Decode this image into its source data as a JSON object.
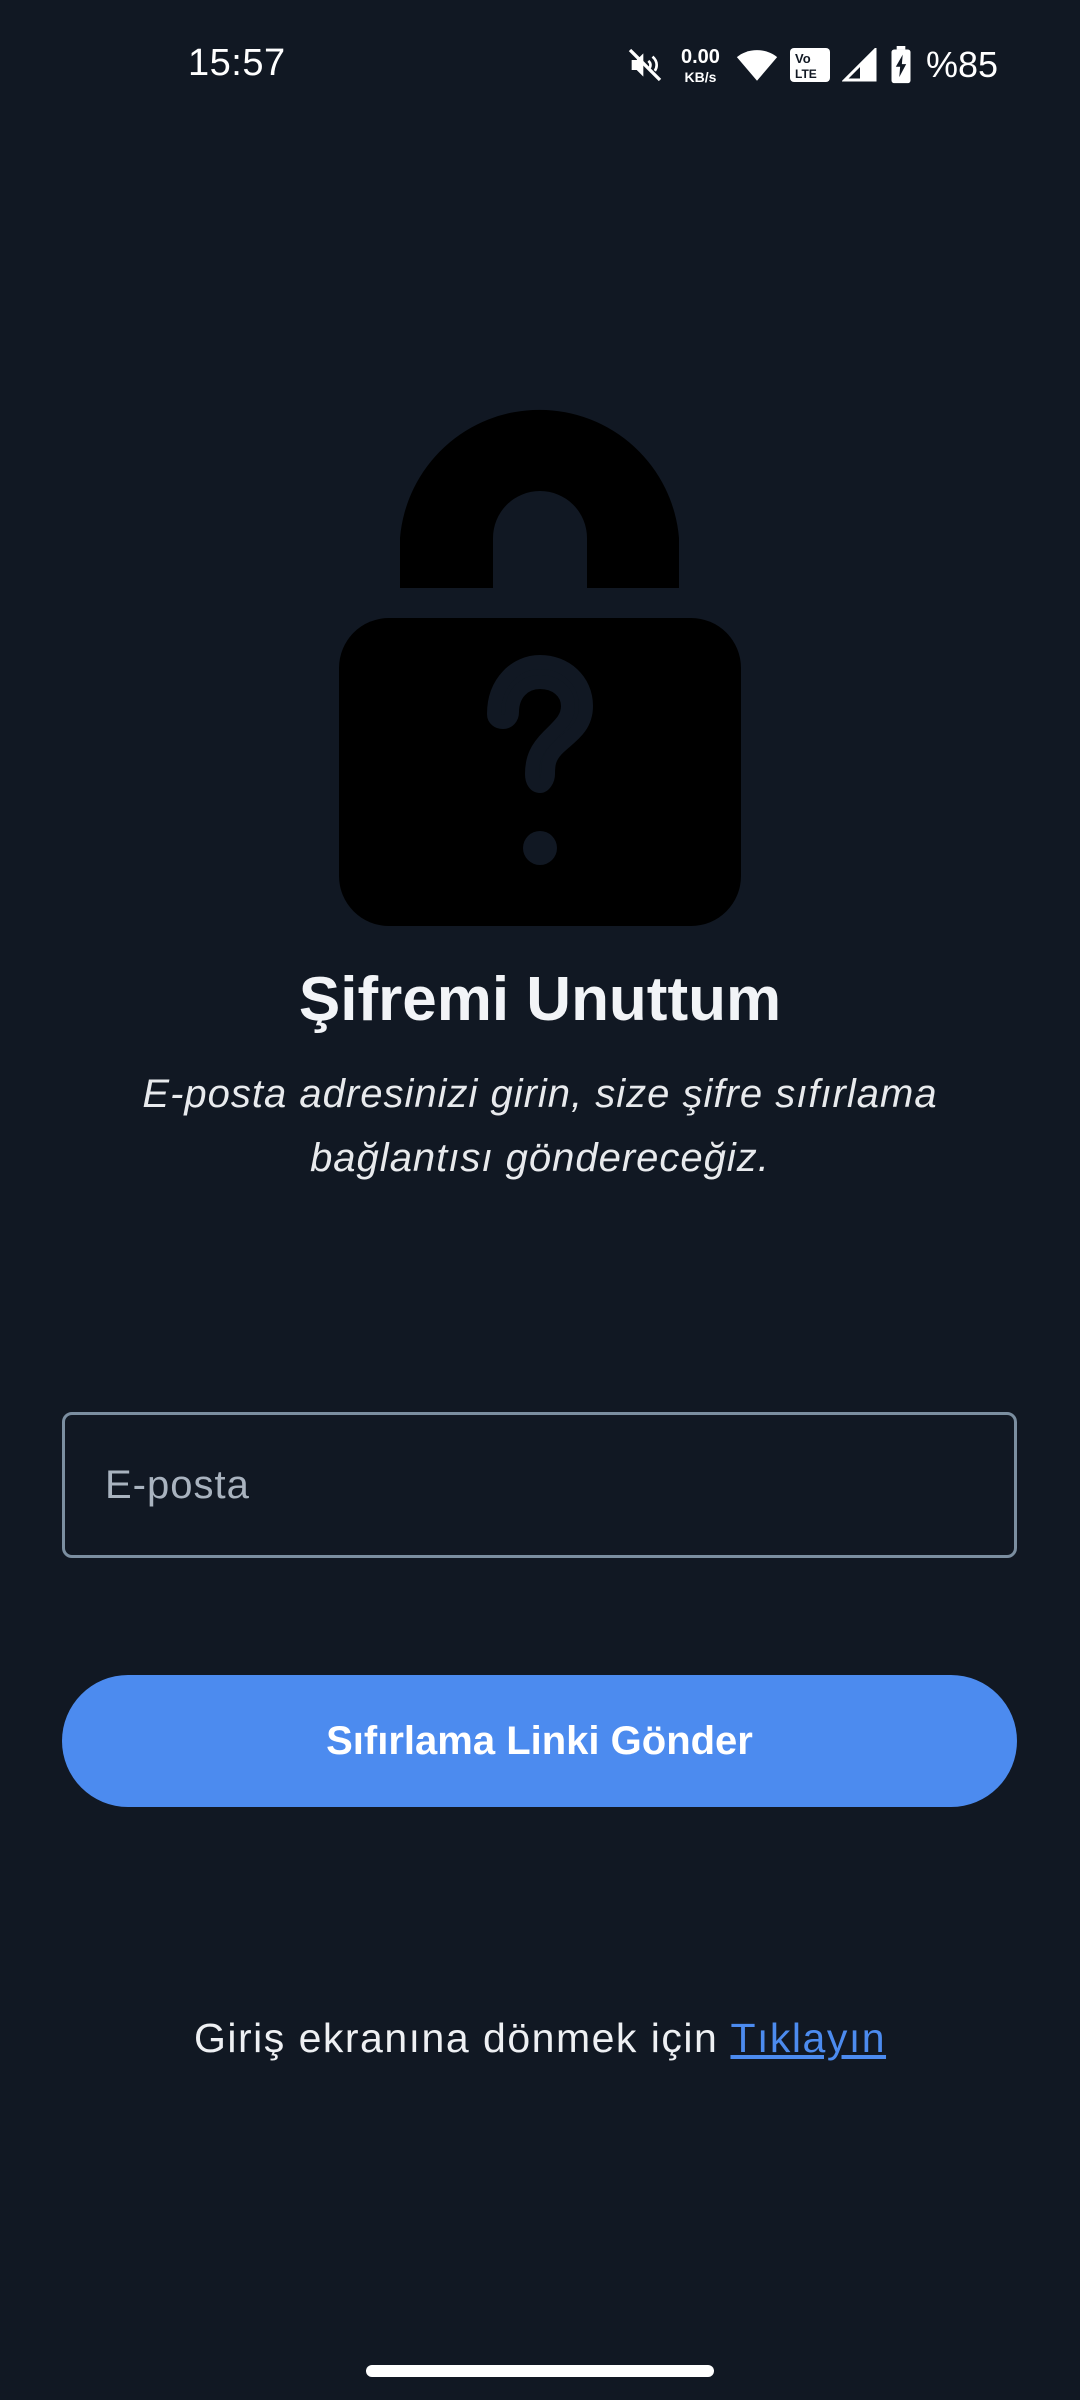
{
  "status_bar": {
    "time": "15:57",
    "net_speed_value": "0.00",
    "net_speed_unit": "KB/s",
    "volte_label_top": "Vo",
    "volte_label_bottom": "LTE",
    "battery_percent": "%85",
    "icons": [
      "mute-icon",
      "wifi-icon",
      "volte-icon",
      "signal-icon",
      "battery-charging-icon"
    ]
  },
  "hero": {
    "icon": "lock-question-icon",
    "title": "Şifremi Unuttum",
    "subtitle": "E-posta adresinizi girin, size şifre sıfırlama bağlantısı göndereceğiz."
  },
  "form": {
    "email_placeholder": "E-posta",
    "email_value": "",
    "submit_label": "Sıfırlama Linki Gönder"
  },
  "footer": {
    "back_text": "Giriş ekranına dönmek için ",
    "back_link_label": "Tıklayın"
  },
  "colors": {
    "background": "#111823",
    "accent": "#4c8bef",
    "field_border": "#7b8ea0",
    "lock": "#000000"
  }
}
